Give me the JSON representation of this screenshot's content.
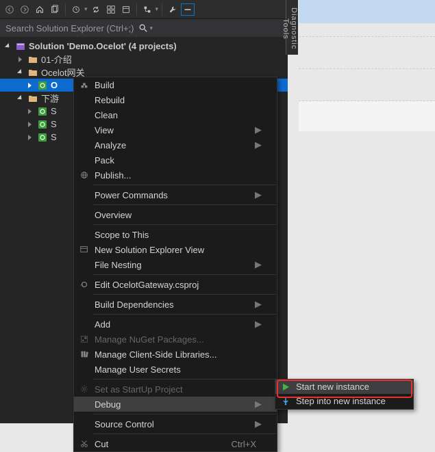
{
  "diagTab": "Diagnostic Tools",
  "search": {
    "placeholder": "Search Solution Explorer (Ctrl+;)"
  },
  "tree": {
    "root": "Solution 'Demo.Ocelot' (4 projects)",
    "f1": "01-介绍",
    "f2": "Ocelot网关",
    "p1": "O",
    "f3": "下游",
    "p2": "S",
    "p3": "S",
    "p4": "S"
  },
  "menu": {
    "build": "Build",
    "rebuild": "Rebuild",
    "clean": "Clean",
    "view": "View",
    "analyze": "Analyze",
    "pack": "Pack",
    "publish": "Publish...",
    "power": "Power Commands",
    "overview": "Overview",
    "scope": "Scope to This",
    "newview": "New Solution Explorer View",
    "nesting": "File Nesting",
    "edit": "Edit OcelotGateway.csproj",
    "deps": "Build Dependencies",
    "add": "Add",
    "nuget": "Manage NuGet Packages...",
    "client": "Manage Client-Side Libraries...",
    "secrets": "Manage User Secrets",
    "startup": "Set as StartUp Project",
    "debug": "Debug",
    "source": "Source Control",
    "cut": "Cut",
    "cut_sc": "Ctrl+X"
  },
  "submenu": {
    "start": "Start new instance",
    "step": "Step into new instance"
  }
}
